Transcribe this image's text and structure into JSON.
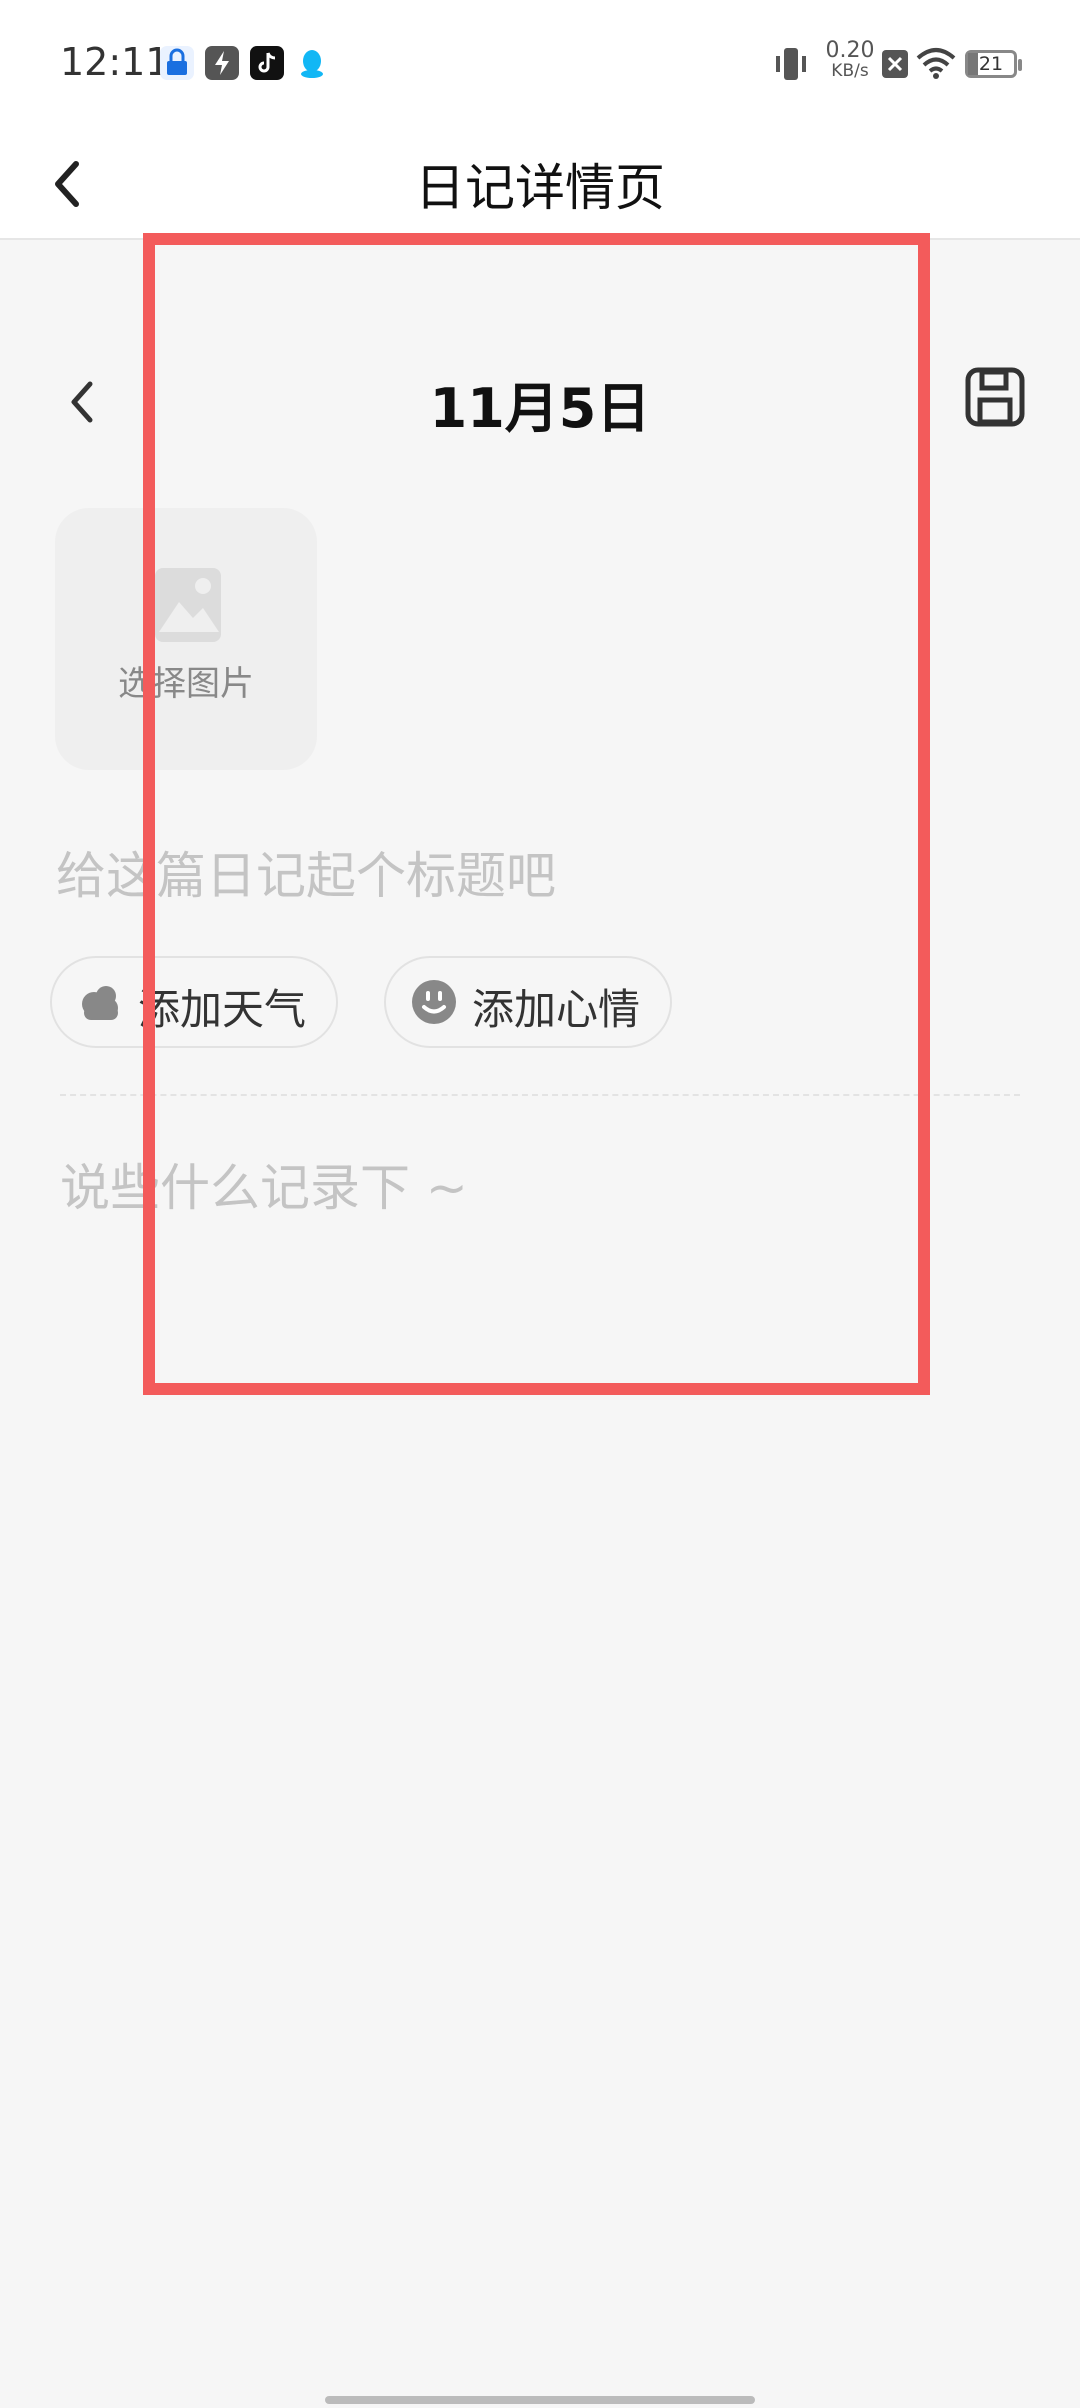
{
  "status_bar": {
    "time": "12:11",
    "net_speed_value": "0.20",
    "net_speed_unit": "KB/s",
    "battery": "21",
    "icons": [
      "vpn-lock-icon",
      "flash-app-icon",
      "tiktok-icon",
      "qq-icon",
      "vibrate-icon",
      "no-sim-icon",
      "wifi-icon",
      "battery-icon"
    ]
  },
  "header": {
    "title": "日记详情页",
    "back_icon": "chevron-left-icon"
  },
  "diary": {
    "date": "11月5日",
    "select_image_label": "选择图片",
    "title_placeholder": "给这篇日记起个标题吧",
    "weather_label": "添加天气",
    "mood_label": "添加心情",
    "content_placeholder": "说些什么记录下 ~"
  },
  "colors": {
    "highlight": "#f35b5b",
    "background": "#f6f6f6",
    "placeholder": "#c4c4c4"
  }
}
